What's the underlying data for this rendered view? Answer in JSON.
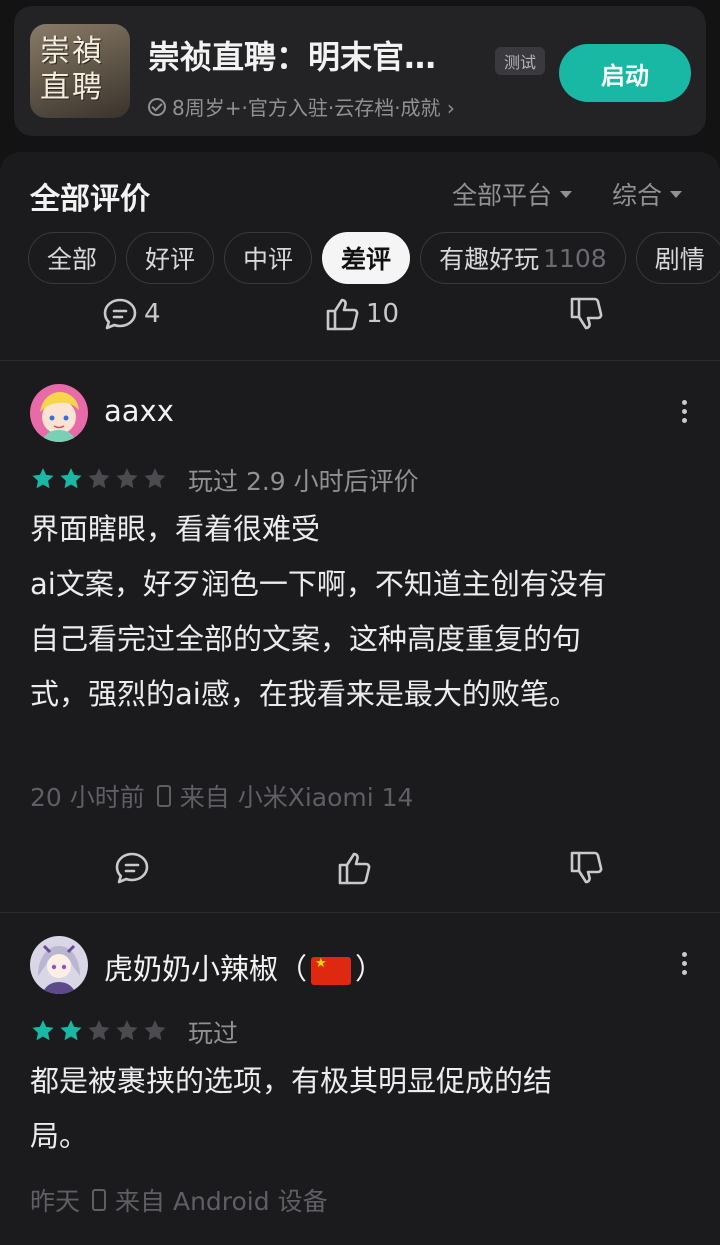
{
  "game": {
    "icon_text_line1": "崇禎",
    "icon_text_line2": "直聘",
    "title": "崇祯直聘：明末官…",
    "badge": "测试",
    "meta": "8周岁+·官方入驻·云存档·成就 ›",
    "launch_label": "启动"
  },
  "reviews_header": {
    "title": "全部评价",
    "platform_filter": "全部平台",
    "sort_filter": "综合"
  },
  "chips": [
    {
      "label": "全部",
      "count": ""
    },
    {
      "label": "好评",
      "count": ""
    },
    {
      "label": "中评",
      "count": ""
    },
    {
      "label": "差评",
      "count": ""
    },
    {
      "label": "有趣好玩",
      "count": "1108"
    },
    {
      "label": "剧情",
      "count": ""
    }
  ],
  "active_chip": "差评",
  "top_actions": {
    "comment_count": "4",
    "like_count": "10"
  },
  "reviews": [
    {
      "username": "aaxx",
      "rating": 2,
      "played": "玩过  2.9  小时后评价",
      "body": [
        "界面瞎眼，看着很难受",
        "ai文案，好歹润色一下啊，不知道主创有没有",
        "自己看完过全部的文案，这种高度重复的句",
        "式，强烈的ai感，在我看来是最大的败笔。"
      ],
      "time": "20  小时前",
      "device": "来自  小米Xiaomi 14"
    },
    {
      "username_prefix": "虎奶奶小辣椒（",
      "username_suffix": "）",
      "rating": 2,
      "played": "玩过",
      "body": [
        "都是被裹挟的选项，有极其明显促成的结",
        "局。"
      ],
      "time": "昨天",
      "device": "来自  Android  设备"
    }
  ],
  "colors": {
    "accent": "#19b8a4",
    "star_on": "#19b8a4",
    "star_off": "#4a4a4f",
    "background": "#131314",
    "panel": "#1b1b1d"
  }
}
